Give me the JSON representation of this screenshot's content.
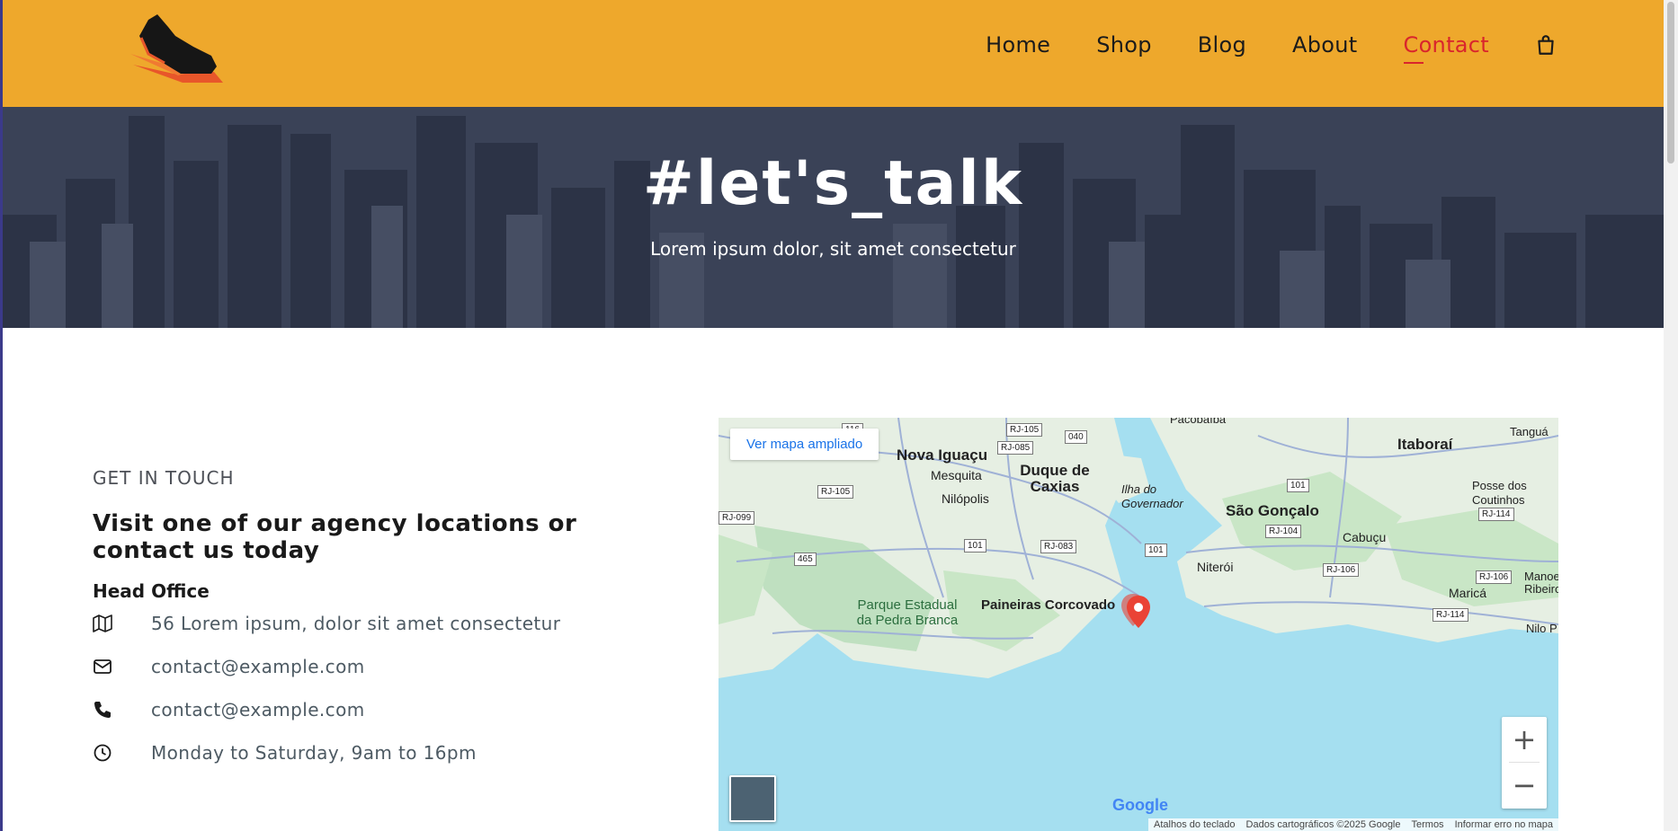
{
  "header": {
    "nav": [
      "Home",
      "Shop",
      "Blog",
      "About",
      "Contact"
    ],
    "active_nav": "Contact",
    "accent": "#eea82c",
    "active_color": "#d9252c"
  },
  "hero": {
    "title": "#let's_talk",
    "subtitle": "Lorem ipsum dolor, sit amet consectetur"
  },
  "contact": {
    "eyebrow": "GET IN TOUCH",
    "heading": "Visit one of our agency locations or contact us today",
    "office_title": "Head Office",
    "items": [
      {
        "icon": "map-icon",
        "text": "56 Lorem ipsum, dolor sit amet consectetur"
      },
      {
        "icon": "envelope-icon",
        "text": "contact@example.com"
      },
      {
        "icon": "phone-icon",
        "text": "contact@example.com"
      },
      {
        "icon": "clock-icon",
        "text": "Monday to Saturday, 9am to 16pm"
      }
    ]
  },
  "map": {
    "link": "Ver mapa ampliado",
    "zoom_in": "+",
    "zoom_out": "−",
    "google": "Google",
    "attribution": [
      "Atalhos do teclado",
      "Dados cartográficos ©2025 Google",
      "Termos",
      "Informar erro no mapa"
    ],
    "places": {
      "pacobaiba": "Pacobaíba",
      "nova_iguacu": "Nova Iguaçu",
      "mesquita": "Mesquita",
      "duque": "Duque de Caxias",
      "nilopolis": "Nilópolis",
      "ilha": "Ilha do Governador",
      "itaborai": "Itaboraí",
      "sao_goncalo": "São Gonçalo",
      "cabucu": "Cabuçu",
      "posse": "Posse dos Coutinhos",
      "niteroi": "Niterói",
      "marica": "Maricá",
      "parque": "Parque Estadual da Pedra Branca",
      "paineiras": "Paineiras Corcovado",
      "tangua": "Tanguá",
      "manoel": "Manoel Ribeiro",
      "nilo": "Nilo P"
    },
    "roads": [
      "RJ-105",
      "040",
      "RJ-085",
      "RJ-105",
      "RJ-099",
      "101",
      "RJ-083",
      "465",
      "101",
      "101",
      "RJ-104",
      "RJ-114",
      "RJ-106",
      "RJ-106",
      "RJ-114",
      "116"
    ]
  }
}
